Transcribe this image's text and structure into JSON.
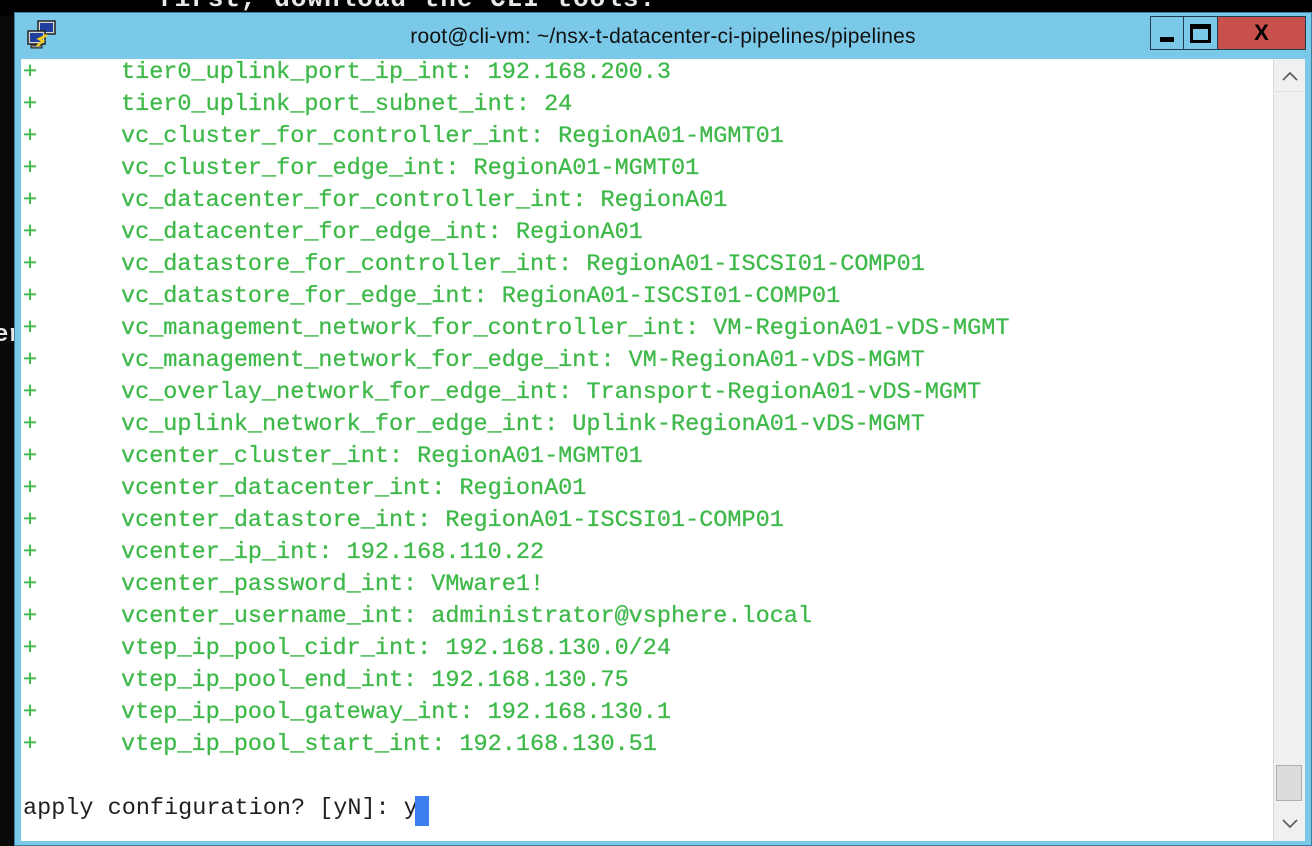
{
  "background": {
    "top_text": "first, download the CLI tools:",
    "left_fragment": "er"
  },
  "window": {
    "title": "root@cli-vm: ~/nsx-t-datacenter-ci-pipelines/pipelines",
    "icon": "putty-app-icon",
    "controls": {
      "minimize": "minimize-icon",
      "maximize": "maximize-icon",
      "close": "X"
    },
    "colors": {
      "titlebar": "#7ac9e8",
      "close": "#c7504a",
      "text_green": "#3fb94a",
      "cursor": "#3d7ff0"
    }
  },
  "terminal": {
    "diff_prefix": "+",
    "lines": [
      "tier0_uplink_port_ip_int: 192.168.200.3",
      "tier0_uplink_port_subnet_int: 24",
      "vc_cluster_for_controller_int: RegionA01-MGMT01",
      "vc_cluster_for_edge_int: RegionA01-MGMT01",
      "vc_datacenter_for_controller_int: RegionA01",
      "vc_datacenter_for_edge_int: RegionA01",
      "vc_datastore_for_controller_int: RegionA01-ISCSI01-COMP01",
      "vc_datastore_for_edge_int: RegionA01-ISCSI01-COMP01",
      "vc_management_network_for_controller_int: VM-RegionA01-vDS-MGMT",
      "vc_management_network_for_edge_int: VM-RegionA01-vDS-MGMT",
      "vc_overlay_network_for_edge_int: Transport-RegionA01-vDS-MGMT",
      "vc_uplink_network_for_edge_int: Uplink-RegionA01-vDS-MGMT",
      "vcenter_cluster_int: RegionA01-MGMT01",
      "vcenter_datacenter_int: RegionA01",
      "vcenter_datastore_int: RegionA01-ISCSI01-COMP01",
      "vcenter_ip_int: 192.168.110.22",
      "vcenter_password_int: VMware1!",
      "vcenter_username_int: administrator@vsphere.local",
      "vtep_ip_pool_cidr_int: 192.168.130.0/24",
      "vtep_ip_pool_end_int: 192.168.130.75",
      "vtep_ip_pool_gateway_int: 192.168.130.1",
      "vtep_ip_pool_start_int: 192.168.130.51"
    ],
    "prompt": "apply configuration? [yN]: ",
    "input_value": "y"
  },
  "scrollbar": {
    "up_icon": "scroll-up-arrow-icon",
    "down_icon": "scroll-down-arrow-icon",
    "position": 0.95
  }
}
